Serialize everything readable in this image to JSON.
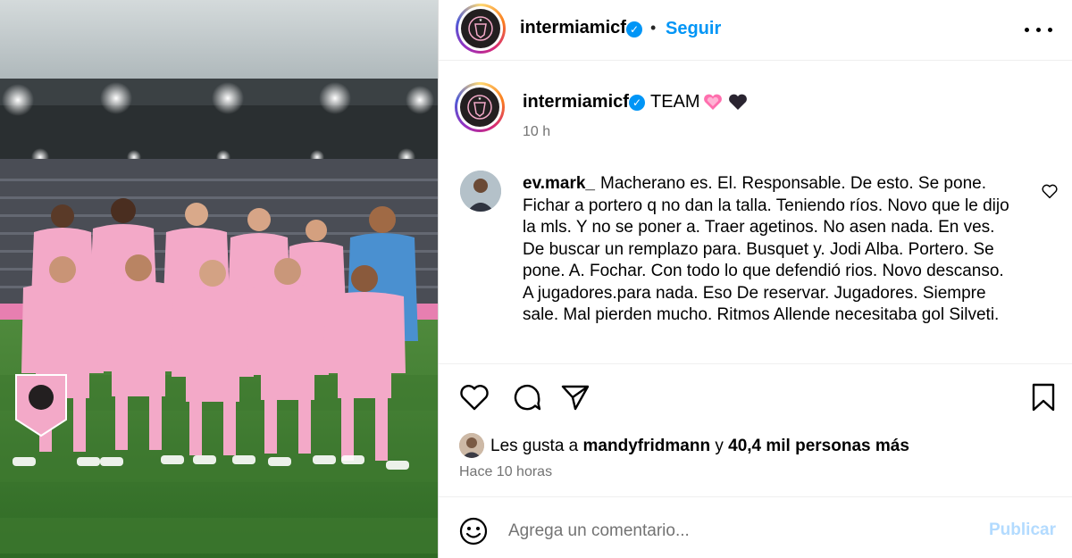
{
  "post": {
    "username": "intermiamicf",
    "verified_glyph": "✓",
    "follow_separator": "•",
    "follow_label": "Seguir",
    "more_icon": "more-horizontal-icon"
  },
  "caption": {
    "username": "intermiamicf",
    "text": "TEAM",
    "emojis": [
      "pink-heart-icon",
      "black-heart-icon"
    ],
    "time": "10 h"
  },
  "comment": {
    "username": "ev.mark_",
    "text": "Macherano es. El. Responsable. De esto. Se pone. Fichar a portero q no dan la talla. Teniendo ríos. Novo que le dijo la mls. Y no se poner a. Traer agetinos. No asen nada. En ves. De buscar un remplazo para. Busquet y. Jodi Alba. Portero. Se pone. A. Fochar. Con todo lo que defendió rios. Novo descanso. A jugadores.para nada. Eso De reservar. Jugadores. Siempre sale. Mal pierden mucho. Ritmos Allende necesitaba gol Silveti."
  },
  "likes": {
    "prefix": "Les gusta a",
    "user": "mandyfridmann",
    "connector": "y",
    "others": "40,4 mil personas más"
  },
  "post_time": "Hace 10 horas",
  "comment_box": {
    "placeholder": "Agrega un comentario...",
    "publish_label": "Publicar"
  },
  "colors": {
    "accent": "#0095f6",
    "publish_disabled": "#b3dbff",
    "jersey_pink": "#f3a9c8",
    "keeper_blue": "#4a90d0"
  }
}
